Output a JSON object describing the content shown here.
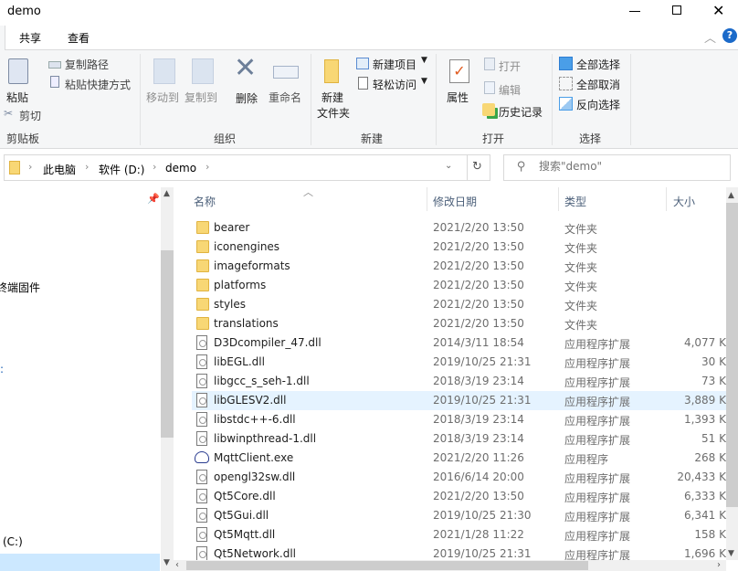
{
  "window": {
    "title": "demo",
    "minimize_icon": "minimize-icon",
    "maximize_icon": "maximize-icon",
    "close_icon": "close-icon"
  },
  "tabs": [
    {
      "label": "共享"
    },
    {
      "label": "查看"
    }
  ],
  "ribbon": {
    "clipboard": {
      "group": "剪贴板",
      "paste": "粘贴",
      "copy_path": "复制路径",
      "paste_shortcut": "粘贴快捷方式",
      "cut": "剪切"
    },
    "organize": {
      "group": "组织",
      "move_to": "移动到",
      "copy_to": "复制到",
      "delete": "删除",
      "rename": "重命名"
    },
    "new": {
      "group": "新建",
      "new_folder": "新建\n文件夹",
      "new_folder_l1": "新建",
      "new_folder_l2": "文件夹",
      "new_item": "新建项目",
      "easy_access": "轻松访问"
    },
    "open": {
      "group": "打开",
      "properties": "属性",
      "open": "打开",
      "edit": "编辑",
      "history": "历史记录"
    },
    "select": {
      "group": "选择",
      "select_all": "全部选择",
      "select_none": "全部取消",
      "invert": "反向选择"
    }
  },
  "address": {
    "crumbs": [
      "此电脑",
      "软件 (D:)",
      "demo"
    ]
  },
  "search": {
    "placeholder": "搜索\"demo\""
  },
  "nav": {
    "items": [
      "终端固件",
      "(C:)"
    ]
  },
  "columns": {
    "name": "名称",
    "date": "修改日期",
    "type": "类型",
    "size": "大小"
  },
  "files": [
    {
      "name": "bearer",
      "date": "2021/2/20 13:50",
      "type": "文件夹",
      "size": "",
      "kind": "folder"
    },
    {
      "name": "iconengines",
      "date": "2021/2/20 13:50",
      "type": "文件夹",
      "size": "",
      "kind": "folder"
    },
    {
      "name": "imageformats",
      "date": "2021/2/20 13:50",
      "type": "文件夹",
      "size": "",
      "kind": "folder"
    },
    {
      "name": "platforms",
      "date": "2021/2/20 13:50",
      "type": "文件夹",
      "size": "",
      "kind": "folder"
    },
    {
      "name": "styles",
      "date": "2021/2/20 13:50",
      "type": "文件夹",
      "size": "",
      "kind": "folder"
    },
    {
      "name": "translations",
      "date": "2021/2/20 13:50",
      "type": "文件夹",
      "size": "",
      "kind": "folder"
    },
    {
      "name": "D3Dcompiler_47.dll",
      "date": "2014/3/11 18:54",
      "type": "应用程序扩展",
      "size": "4,077 K",
      "kind": "dll"
    },
    {
      "name": "libEGL.dll",
      "date": "2019/10/25 21:31",
      "type": "应用程序扩展",
      "size": "30 K",
      "kind": "dll"
    },
    {
      "name": "libgcc_s_seh-1.dll",
      "date": "2018/3/19 23:14",
      "type": "应用程序扩展",
      "size": "73 K",
      "kind": "dll"
    },
    {
      "name": "libGLESV2.dll",
      "date": "2019/10/25 21:31",
      "type": "应用程序扩展",
      "size": "3,889 K",
      "kind": "dll",
      "hover": true
    },
    {
      "name": "libstdc++-6.dll",
      "date": "2018/3/19 23:14",
      "type": "应用程序扩展",
      "size": "1,393 K",
      "kind": "dll"
    },
    {
      "name": "libwinpthread-1.dll",
      "date": "2018/3/19 23:14",
      "type": "应用程序扩展",
      "size": "51 K",
      "kind": "dll"
    },
    {
      "name": "MqttClient.exe",
      "date": "2021/2/20 11:26",
      "type": "应用程序",
      "size": "268 K",
      "kind": "exe"
    },
    {
      "name": "opengl32sw.dll",
      "date": "2016/6/14 20:00",
      "type": "应用程序扩展",
      "size": "20,433 K",
      "kind": "dll"
    },
    {
      "name": "Qt5Core.dll",
      "date": "2021/2/20 13:50",
      "type": "应用程序扩展",
      "size": "6,333 K",
      "kind": "dll"
    },
    {
      "name": "Qt5Gui.dll",
      "date": "2019/10/25 21:30",
      "type": "应用程序扩展",
      "size": "6,341 K",
      "kind": "dll"
    },
    {
      "name": "Qt5Mqtt.dll",
      "date": "2021/1/28 11:22",
      "type": "应用程序扩展",
      "size": "158 K",
      "kind": "dll"
    },
    {
      "name": "Qt5Network.dll",
      "date": "2019/10/25 21:31",
      "type": "应用程序扩展",
      "size": "1,696 K",
      "kind": "dll"
    }
  ],
  "colors": {
    "hover_row": "#e5f3ff",
    "nav_selected": "#cce8ff",
    "header_text": "#4c607a",
    "folder": "#f8d775"
  }
}
